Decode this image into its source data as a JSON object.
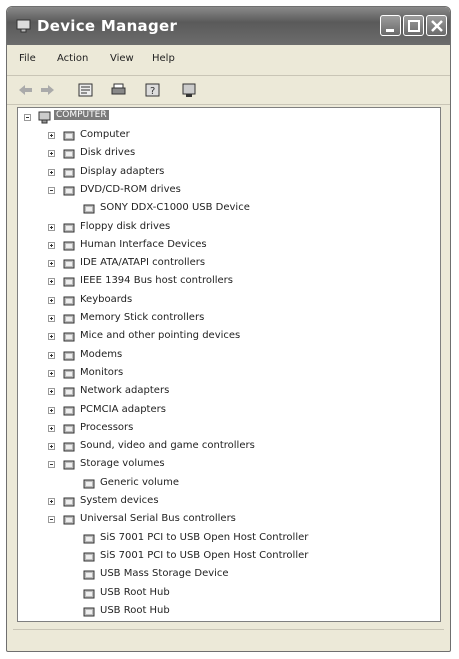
{
  "window": {
    "title": "Device Manager"
  },
  "menu": [
    "File",
    "Action",
    "View",
    "Help"
  ],
  "tree": {
    "root": "COMPUTER",
    "items": [
      {
        "label": "Computer",
        "level": 1,
        "state": "collapsed",
        "icon": "computer-icon"
      },
      {
        "label": "Disk drives",
        "level": 1,
        "state": "collapsed",
        "icon": "disk-drive-icon"
      },
      {
        "label": "Display adapters",
        "level": 1,
        "state": "collapsed",
        "icon": "display-adapter-icon"
      },
      {
        "label": "DVD/CD-ROM drives",
        "level": 1,
        "state": "expanded",
        "icon": "cdrom-icon"
      },
      {
        "label": "SONY DDX-C1000 USB Device",
        "level": 2,
        "state": "leaf",
        "icon": "cdrom-icon"
      },
      {
        "label": "Floppy disk drives",
        "level": 1,
        "state": "collapsed",
        "icon": "floppy-icon"
      },
      {
        "label": "Human Interface Devices",
        "level": 1,
        "state": "collapsed",
        "icon": "hid-icon"
      },
      {
        "label": "IDE ATA/ATAPI controllers",
        "level": 1,
        "state": "collapsed",
        "icon": "ide-controller-icon"
      },
      {
        "label": "IEEE 1394 Bus host controllers",
        "level": 1,
        "state": "collapsed",
        "icon": "ieee1394-icon"
      },
      {
        "label": "Keyboards",
        "level": 1,
        "state": "collapsed",
        "icon": "keyboard-icon"
      },
      {
        "label": "Memory Stick controllers",
        "level": 1,
        "state": "collapsed",
        "icon": "memory-stick-icon"
      },
      {
        "label": "Mice and other pointing devices",
        "level": 1,
        "state": "collapsed",
        "icon": "mouse-icon"
      },
      {
        "label": "Modems",
        "level": 1,
        "state": "collapsed",
        "icon": "modem-icon"
      },
      {
        "label": "Monitors",
        "level": 1,
        "state": "collapsed",
        "icon": "monitor-icon"
      },
      {
        "label": "Network adapters",
        "level": 1,
        "state": "collapsed",
        "icon": "network-adapter-icon"
      },
      {
        "label": "PCMCIA adapters",
        "level": 1,
        "state": "collapsed",
        "icon": "pcmcia-icon"
      },
      {
        "label": "Processors",
        "level": 1,
        "state": "collapsed",
        "icon": "processor-icon"
      },
      {
        "label": "Sound, video and game controllers",
        "level": 1,
        "state": "collapsed",
        "icon": "sound-icon"
      },
      {
        "label": "Storage volumes",
        "level": 1,
        "state": "expanded",
        "icon": "storage-volume-icon"
      },
      {
        "label": "Generic volume",
        "level": 2,
        "state": "leaf",
        "icon": "storage-volume-icon"
      },
      {
        "label": "System devices",
        "level": 1,
        "state": "collapsed",
        "icon": "system-device-icon"
      },
      {
        "label": "Universal Serial Bus controllers",
        "level": 1,
        "state": "expanded",
        "icon": "usb-icon"
      },
      {
        "label": "SiS 7001 PCI to USB Open Host Controller",
        "level": 2,
        "state": "leaf",
        "icon": "usb-icon"
      },
      {
        "label": "SiS 7001 PCI to USB Open Host Controller",
        "level": 2,
        "state": "leaf",
        "icon": "usb-icon"
      },
      {
        "label": "USB Mass Storage Device",
        "level": 2,
        "state": "leaf",
        "icon": "usb-icon"
      },
      {
        "label": "USB Root Hub",
        "level": 2,
        "state": "leaf",
        "icon": "usb-icon"
      },
      {
        "label": "USB Root Hub",
        "level": 2,
        "state": "leaf",
        "icon": "usb-icon"
      }
    ]
  }
}
